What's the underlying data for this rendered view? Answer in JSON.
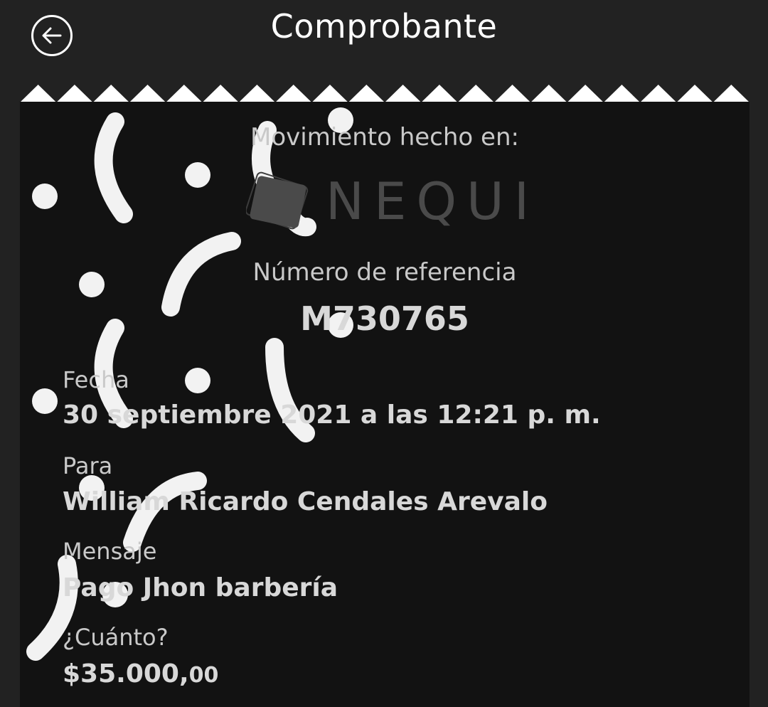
{
  "header": {
    "title": "Comprobante"
  },
  "receipt": {
    "made_in_label": "Movimiento hecho en:",
    "brand": "NEQUI",
    "reference_label": "Número de referencia",
    "reference_value": "M730765",
    "fields": {
      "date_label": "Fecha",
      "date_value": "30 septiembre 2021 a las 12:21 p. m.",
      "to_label": "Para",
      "to_value": "William Ricardo Cendales Arevalo",
      "message_label": "Mensaje",
      "message_value": "Pago Jhon barbería",
      "amount_label": "¿Cuánto?",
      "amount_main": "$35.000,",
      "amount_cents": "00"
    }
  },
  "colors": {
    "background": "#222222",
    "receipt": "#121212",
    "decoration": "#f2f2f2",
    "brand_gray": "#4a4a4a"
  },
  "icons": {
    "back": "arrow-left-icon",
    "logo": "nequi-logo-mark"
  }
}
